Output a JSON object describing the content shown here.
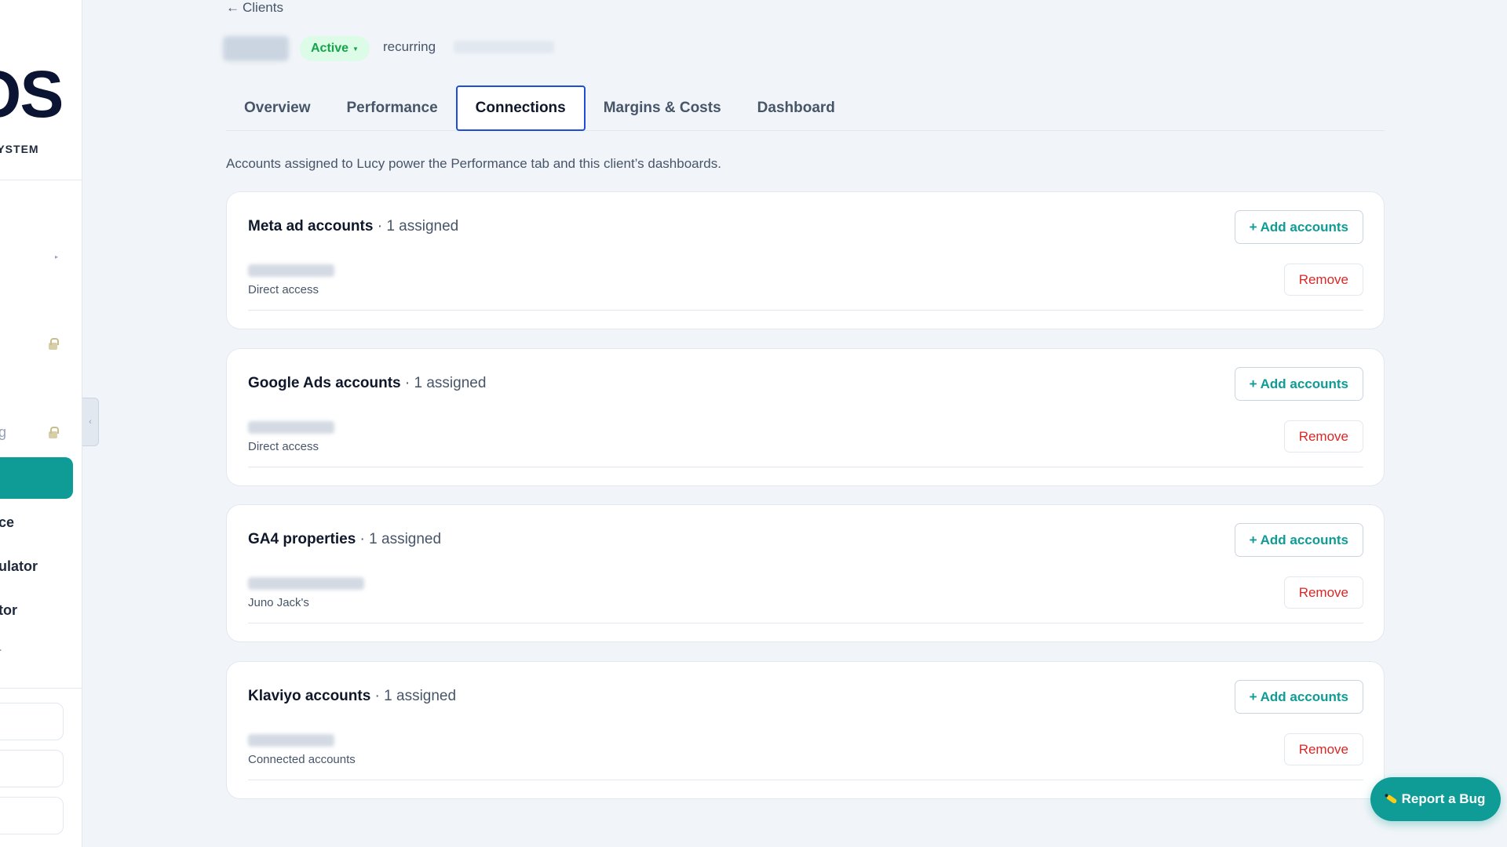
{
  "sidebar": {
    "logo_mark": "OS",
    "logo_subtitle": "SYSTEM",
    "partial_items": [
      "g",
      "ce",
      "ulator",
      "tor",
      "."
    ],
    "collapse_icon": "chevron-left-icon"
  },
  "header": {
    "back_label": "Clients",
    "back_icon": "arrow-left-icon",
    "status": "Active",
    "billing": "recurring"
  },
  "tabs": [
    {
      "label": "Overview",
      "active": false
    },
    {
      "label": "Performance",
      "active": false
    },
    {
      "label": "Connections",
      "active": true
    },
    {
      "label": "Margins & Costs",
      "active": false
    },
    {
      "label": "Dashboard",
      "active": false
    }
  ],
  "intro": "Accounts assigned to Lucy power the Performance tab and this client’s dashboards.",
  "sections": [
    {
      "title": "Meta ad accounts",
      "count": " · 1 assigned",
      "add_label": "+ Add accounts",
      "account_sub": "Direct access",
      "remove_label": "Remove"
    },
    {
      "title": "Google Ads accounts",
      "count": " · 1 assigned",
      "add_label": "+ Add accounts",
      "account_sub": "Direct access",
      "remove_label": "Remove"
    },
    {
      "title": "GA4 properties",
      "count": " · 1 assigned",
      "add_label": "+ Add accounts",
      "account_sub": "Juno Jack's",
      "remove_label": "Remove"
    },
    {
      "title": "Klaviyo accounts",
      "count": " · 1 assigned",
      "add_label": "+ Add accounts",
      "account_sub": "Connected accounts",
      "remove_label": "Remove"
    }
  ],
  "report_bug": "Report a Bug",
  "colors": {
    "accent": "#0f9b96",
    "active_tab_border": "#1d4ed8",
    "status_green": "#16a34a",
    "danger": "#dc2626"
  }
}
